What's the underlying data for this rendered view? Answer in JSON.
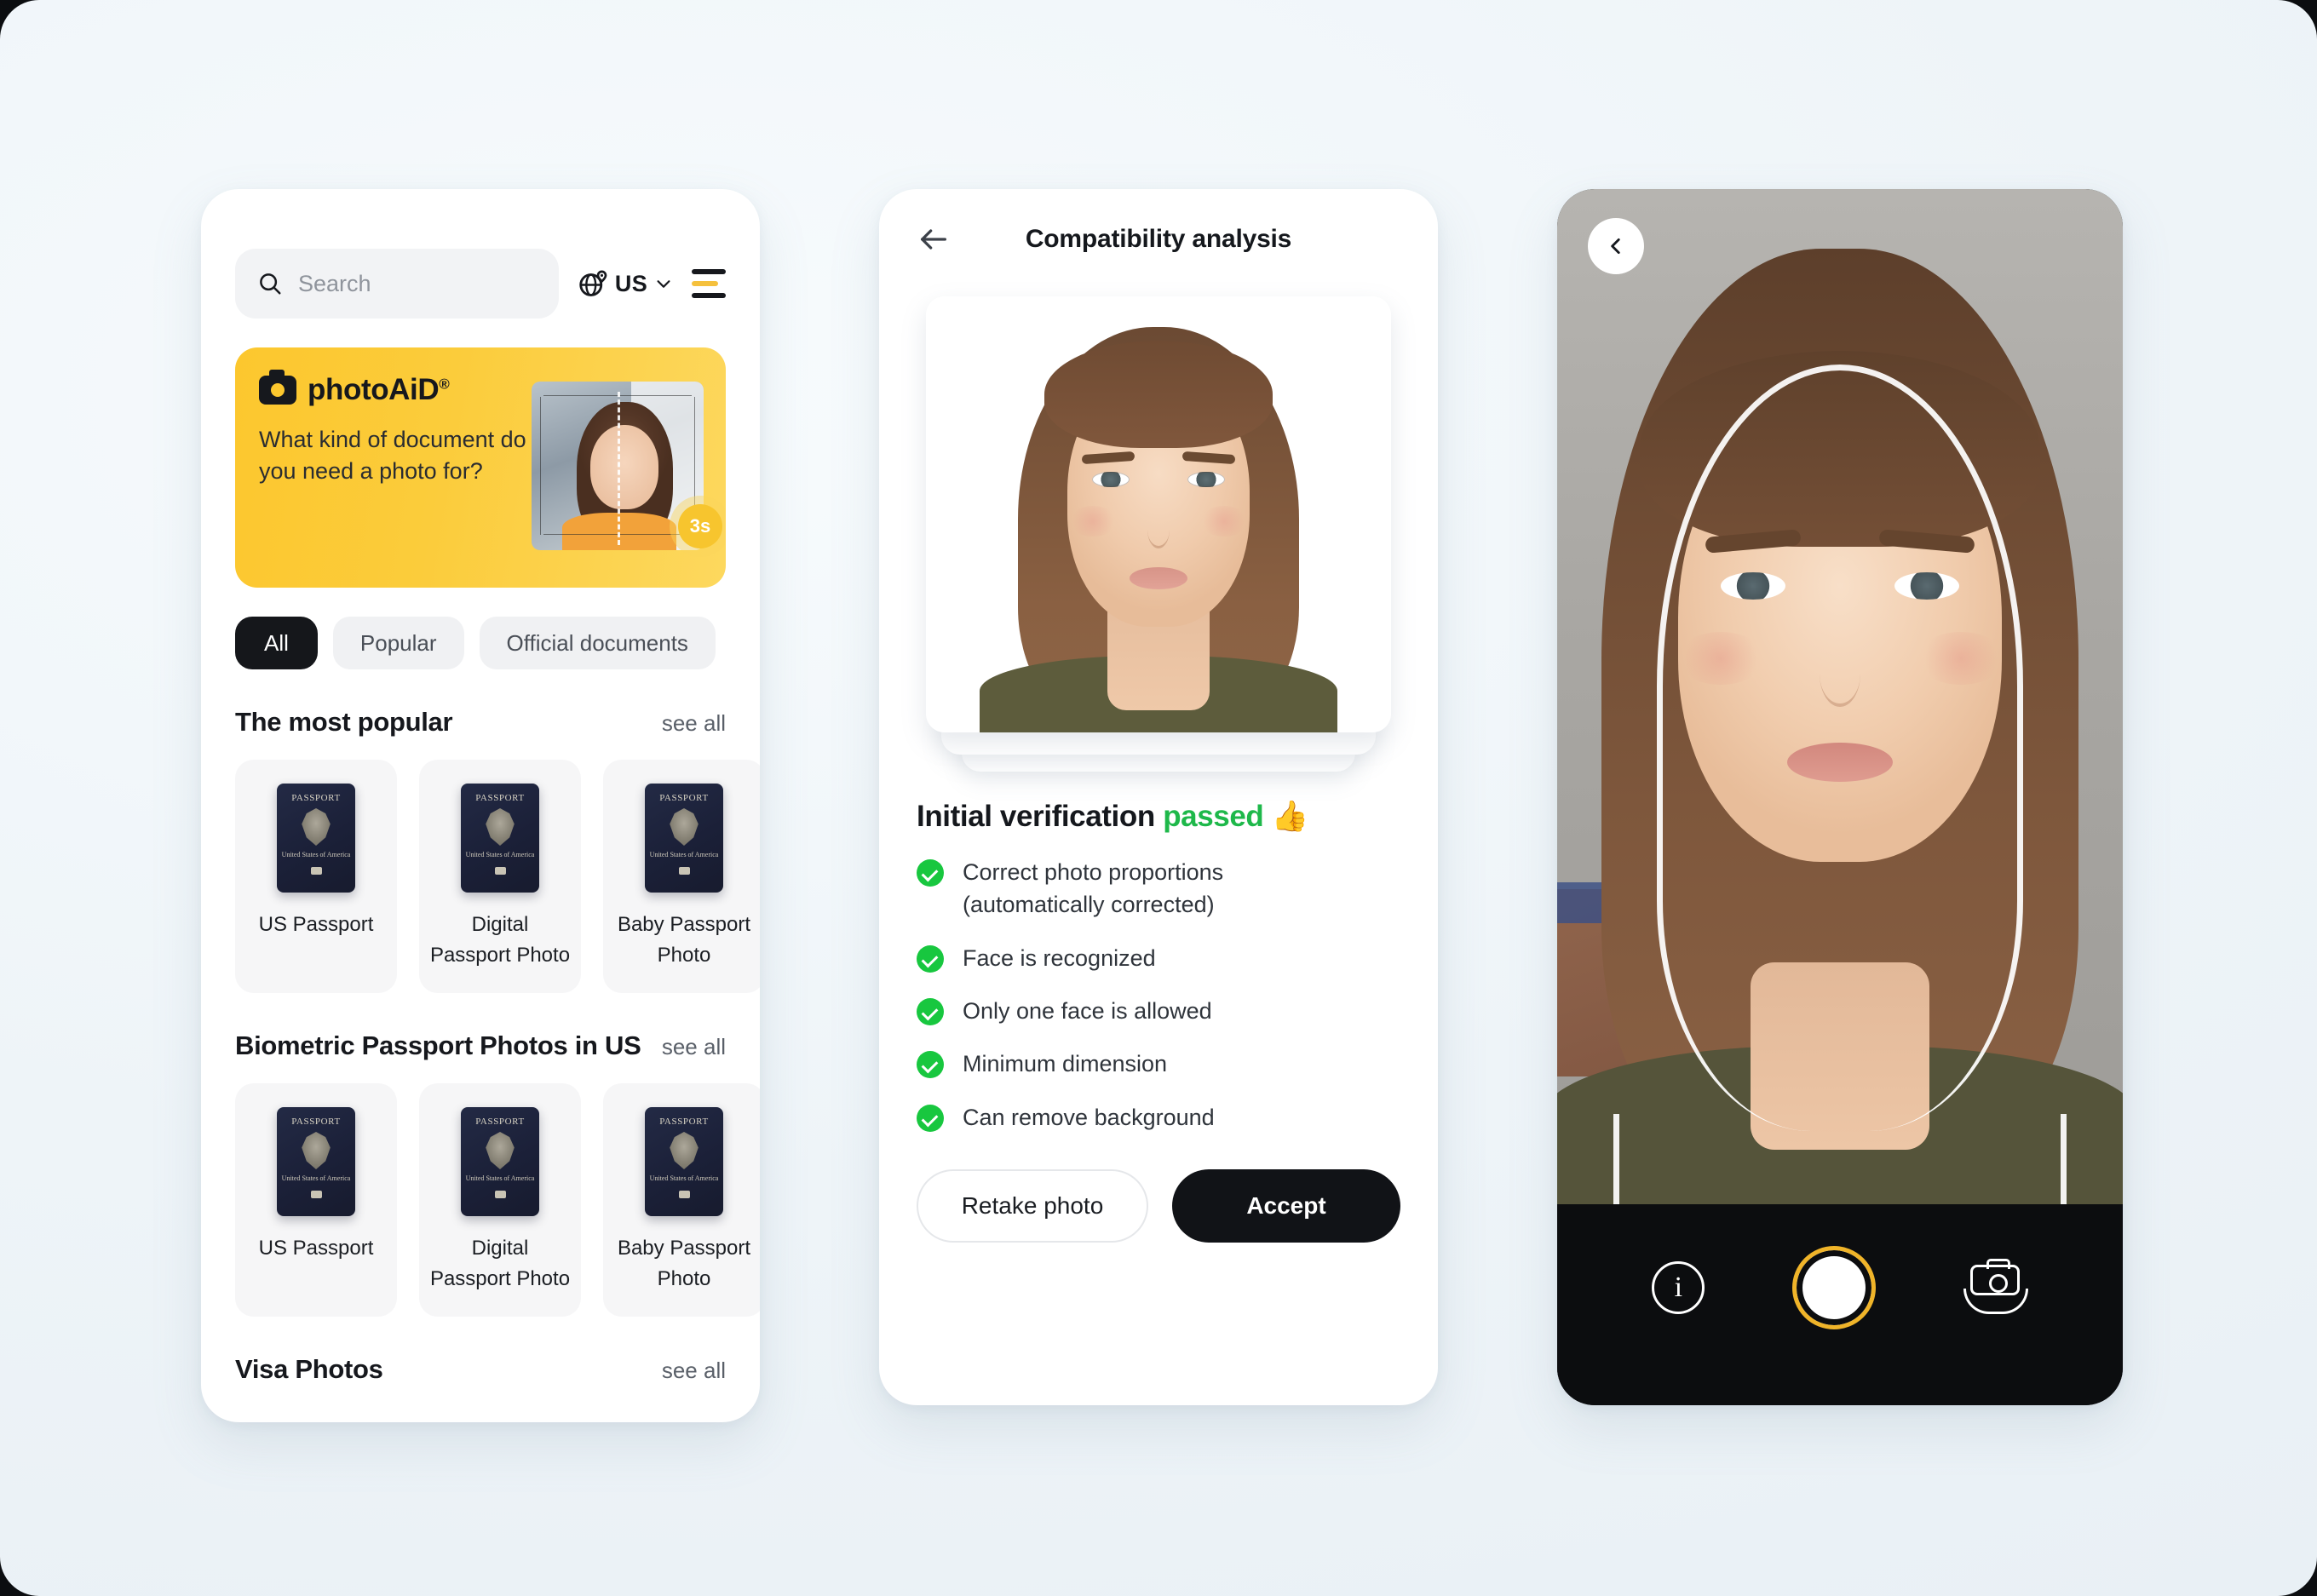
{
  "phone_home": {
    "search": {
      "placeholder": "Search",
      "icon": "search-icon"
    },
    "language": {
      "code": "US",
      "icon": "globe-pin-icon",
      "chevron": "chevron-down-icon"
    },
    "menu_icon": "hamburger-menu-icon",
    "banner": {
      "brand": "photoAiD",
      "brand_mark": "®",
      "question": "What kind of document do you need a photo for?",
      "badge": "3s",
      "bg_color": "#fcc72e"
    },
    "chips": [
      {
        "label": "All",
        "active": true
      },
      {
        "label": "Popular",
        "active": false
      },
      {
        "label": "Official documents",
        "active": false
      }
    ],
    "sections": [
      {
        "title": "The most popular",
        "see_all": "see all",
        "cards": [
          {
            "label": "US Passport",
            "doc_title": "PASSPORT",
            "doc_country": "United States of America"
          },
          {
            "label": "Digital Passport Photo",
            "doc_title": "PASSPORT",
            "doc_country": "United States of America"
          },
          {
            "label": "Baby Passport Photo",
            "doc_title": "PASSPORT",
            "doc_country": "United States of America"
          }
        ]
      },
      {
        "title": "Biometric Passport Photos in US",
        "see_all": "see all",
        "cards": [
          {
            "label": "US Passport",
            "doc_title": "PASSPORT",
            "doc_country": "United States of America"
          },
          {
            "label": "Digital Passport Photo",
            "doc_title": "PASSPORT",
            "doc_country": "United States of America"
          },
          {
            "label": "Baby Passport Photo",
            "doc_title": "PASSPORT",
            "doc_country": "United States of America"
          }
        ]
      },
      {
        "title": "Visa Photos",
        "see_all": "see all",
        "cards": []
      }
    ]
  },
  "phone_analysis": {
    "back_icon": "arrow-left-icon",
    "title": "Compatibility analysis",
    "result": {
      "heading_prefix": "Initial verification",
      "heading_status": "passed",
      "emoji": "👍",
      "status_color": "#1eb84a"
    },
    "checks": [
      "Correct photo proportions (automatically corrected)",
      "Face is recognized",
      "Only one face is allowed",
      "Minimum dimension",
      "Can remove background"
    ],
    "actions": {
      "secondary": "Retake photo",
      "primary": "Accept"
    }
  },
  "phone_camera": {
    "back_icon": "chevron-left-icon",
    "face_guide": "face-outline-guide",
    "controls": {
      "info": "i",
      "info_icon": "info-icon",
      "shutter_icon": "shutter-button",
      "flip_icon": "flip-camera-icon",
      "shutter_ring_color": "#f0b429"
    }
  }
}
